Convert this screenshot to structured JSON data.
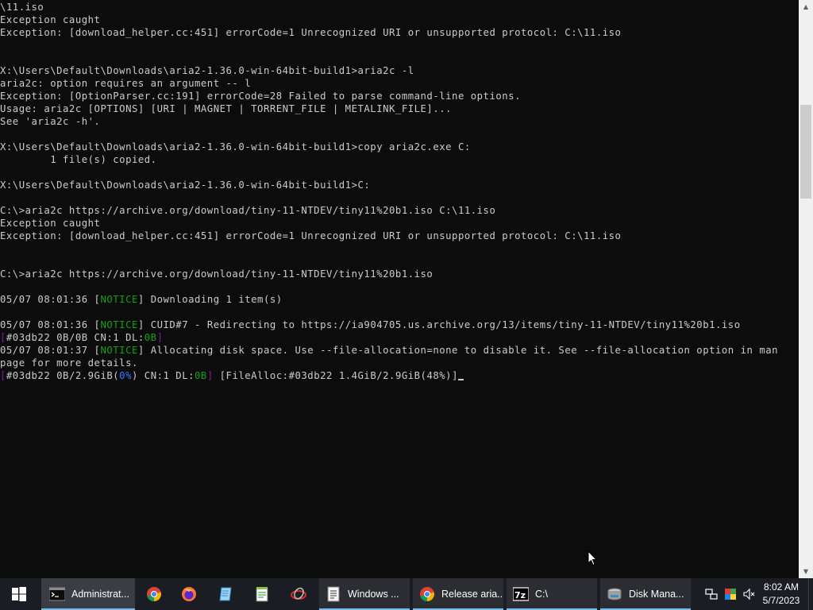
{
  "console": {
    "lines": [
      [
        {
          "t": "\\11.iso",
          "c": "default"
        }
      ],
      [
        {
          "t": "Exception caught",
          "c": "default"
        }
      ],
      [
        {
          "t": "Exception: [download_helper.cc:451] errorCode=1 Unrecognized URI or unsupported protocol: C:\\11.iso",
          "c": "default"
        }
      ],
      [],
      [],
      [
        {
          "t": "X:\\Users\\Default\\Downloads\\aria2-1.36.0-win-64bit-build1>aria2c -l",
          "c": "default"
        }
      ],
      [
        {
          "t": "aria2c: option requires an argument -- l",
          "c": "default"
        }
      ],
      [
        {
          "t": "Exception: [OptionParser.cc:191] errorCode=28 Failed to parse command-line options.",
          "c": "default"
        }
      ],
      [
        {
          "t": "Usage: aria2c [OPTIONS] [URI | MAGNET | TORRENT_FILE | METALINK_FILE]...",
          "c": "default"
        }
      ],
      [
        {
          "t": "See 'aria2c -h'.",
          "c": "default"
        }
      ],
      [],
      [
        {
          "t": "X:\\Users\\Default\\Downloads\\aria2-1.36.0-win-64bit-build1>copy aria2c.exe C:",
          "c": "default"
        }
      ],
      [
        {
          "t": "        1 file(s) copied.",
          "c": "default"
        }
      ],
      [],
      [
        {
          "t": "X:\\Users\\Default\\Downloads\\aria2-1.36.0-win-64bit-build1>C:",
          "c": "default"
        }
      ],
      [],
      [
        {
          "t": "C:\\>aria2c https://archive.org/download/tiny-11-NTDEV/tiny11%20b1.iso C:\\11.iso",
          "c": "default"
        }
      ],
      [
        {
          "t": "Exception caught",
          "c": "default"
        }
      ],
      [
        {
          "t": "Exception: [download_helper.cc:451] errorCode=1 Unrecognized URI or unsupported protocol: C:\\11.iso",
          "c": "default"
        }
      ],
      [],
      [],
      [
        {
          "t": "C:\\>aria2c https://archive.org/download/tiny-11-NTDEV/tiny11%20b1.iso",
          "c": "default"
        }
      ],
      [],
      [
        {
          "t": "05/07 08:01:36 [",
          "c": "default"
        },
        {
          "t": "NOTICE",
          "c": "green"
        },
        {
          "t": "] Downloading 1 item(s)",
          "c": "default"
        }
      ],
      [],
      [
        {
          "t": "05/07 08:01:36 [",
          "c": "default"
        },
        {
          "t": "NOTICE",
          "c": "green"
        },
        {
          "t": "] CUID#7 - Redirecting to https://ia904705.us.archive.org/13/items/tiny-11-NTDEV/tiny11%20b1.iso",
          "c": "default"
        }
      ],
      [
        {
          "t": "[",
          "c": "purple"
        },
        {
          "t": "#03db22 0B/0B CN:1 DL:",
          "c": "default"
        },
        {
          "t": "0B",
          "c": "green"
        },
        {
          "t": "]",
          "c": "purple"
        }
      ],
      [
        {
          "t": "05/07 08:01:37 [",
          "c": "default"
        },
        {
          "t": "NOTICE",
          "c": "green"
        },
        {
          "t": "] Allocating disk space. Use --file-allocation=none to disable it. See --file-allocation option in man",
          "c": "default"
        }
      ],
      [
        {
          "t": "page for more details.",
          "c": "default"
        }
      ],
      [
        {
          "t": "[",
          "c": "purple"
        },
        {
          "t": "#03db22 0B/2.9GiB(",
          "c": "default"
        },
        {
          "t": "0%",
          "c": "blue"
        },
        {
          "t": ") CN:1 DL:",
          "c": "default"
        },
        {
          "t": "0B",
          "c": "green"
        },
        {
          "t": "]",
          "c": "purple"
        },
        {
          "t": " [FileAlloc:#03db22 1.4GiB/2.9GiB(48%)]",
          "c": "default"
        }
      ]
    ]
  },
  "taskbar": {
    "items": [
      {
        "name": "start-button",
        "label": "",
        "icon": "windows-logo-icon",
        "state": "none"
      },
      {
        "name": "taskbar-cmd-administrator",
        "label": "Administrat...",
        "icon": "command-prompt-icon",
        "state": "active"
      },
      {
        "name": "taskbar-chrome",
        "label": "",
        "icon": "chrome-icon",
        "state": "none"
      },
      {
        "name": "taskbar-firefox",
        "label": "",
        "icon": "firefox-icon",
        "state": "none"
      },
      {
        "name": "taskbar-notepad",
        "label": "",
        "icon": "notepad-icon",
        "state": "none"
      },
      {
        "name": "taskbar-notepadpp",
        "label": "",
        "icon": "notepadpp-icon",
        "state": "none"
      },
      {
        "name": "taskbar-network-tool",
        "label": "",
        "icon": "network-tool-icon",
        "state": "none"
      },
      {
        "name": "taskbar-windows",
        "label": "Windows ...",
        "icon": "document-icon",
        "state": "open"
      },
      {
        "name": "taskbar-release-aria",
        "label": "Release aria...",
        "icon": "chrome-icon",
        "state": "open"
      },
      {
        "name": "taskbar-7zip",
        "label": "C:\\",
        "icon": "7zip-icon",
        "state": "open"
      },
      {
        "name": "taskbar-disk-management",
        "label": "Disk Mana...",
        "icon": "disk-management-icon",
        "state": "open"
      }
    ],
    "tray": {
      "icons": [
        "network-icon",
        "color-icon",
        "volume-muted-icon"
      ],
      "time": "8:02 AM",
      "date": "5/7/2023"
    }
  }
}
